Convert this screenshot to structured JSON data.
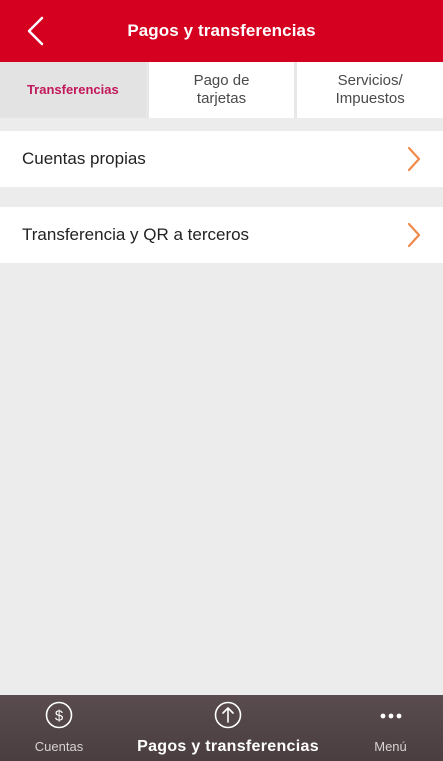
{
  "header": {
    "title": "Pagos y transferencias",
    "back_icon": "chevron-left-icon"
  },
  "tabs": [
    {
      "label": "Transferencias",
      "active": true
    },
    {
      "label": "Pago de\ntarjetas",
      "active": false
    },
    {
      "label": "Servicios/\nImpuestos",
      "active": false
    }
  ],
  "list": {
    "items": [
      {
        "label": "Cuentas propias",
        "icon": "chevron-right-icon"
      },
      {
        "label": "Transferencia y QR a terceros",
        "icon": "chevron-right-icon"
      }
    ]
  },
  "bottom_nav": {
    "items": [
      {
        "label": "Cuentas",
        "icon": "dollar-circle-icon",
        "active": false
      },
      {
        "label": "Pagos y transferencias",
        "icon": "arrow-up-circle-icon",
        "active": true
      },
      {
        "label": "Menú",
        "icon": "more-dots-icon",
        "active": false
      }
    ]
  },
  "colors": {
    "brand_red": "#d5001f",
    "active_tab_text": "#c2185b",
    "chevron_orange": "#f08a4b",
    "bottom_nav_bg": "#4f4345"
  }
}
